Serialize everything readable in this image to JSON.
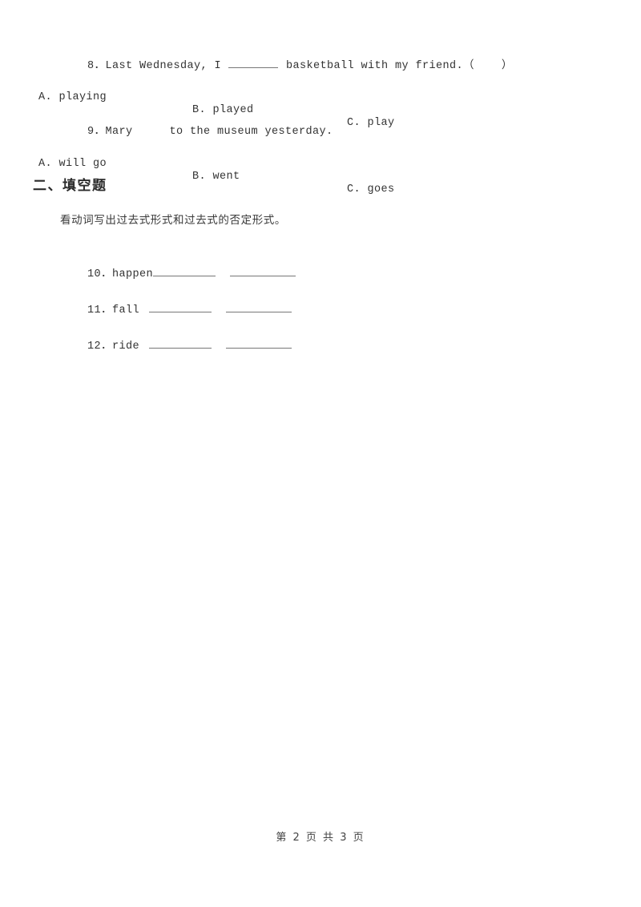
{
  "document": {
    "page_background": "#ffffff",
    "text_color": "#333333"
  },
  "questions": [
    {
      "number": "8",
      "separator": "．",
      "text_before_blank": "Last Wednesday, I ",
      "text_after_blank": " basketball with my friend.",
      "answer_bracket": "（    ）",
      "options": [
        {
          "letter": "A.",
          "label": "A. playing"
        },
        {
          "letter": "B.",
          "label": "B. played"
        },
        {
          "letter": "C.",
          "label": "C. play"
        }
      ]
    },
    {
      "number": "9",
      "separator": "．",
      "text_before_blank": "Mary",
      "text_after_blank": "to the museum yesterday.",
      "options": [
        {
          "letter": "A.",
          "label": "A. will go"
        },
        {
          "letter": "B.",
          "label": "B. went"
        },
        {
          "letter": "C.",
          "label": "C. goes"
        }
      ]
    }
  ],
  "section": {
    "heading": "二、填空题",
    "instruction": "看动词写出过去式形式和过去式的否定形式。"
  },
  "fill_items": [
    {
      "number": "10",
      "separator": "．",
      "word": "happen",
      "space_before_blank": false
    },
    {
      "number": "11",
      "separator": "．",
      "word": "fall",
      "space_before_blank": true
    },
    {
      "number": "12",
      "separator": "．",
      "word": "ride",
      "space_before_blank": true
    }
  ],
  "footer": {
    "text": "第 2 页 共 3 页",
    "current_page": "2",
    "total_pages": "3"
  }
}
